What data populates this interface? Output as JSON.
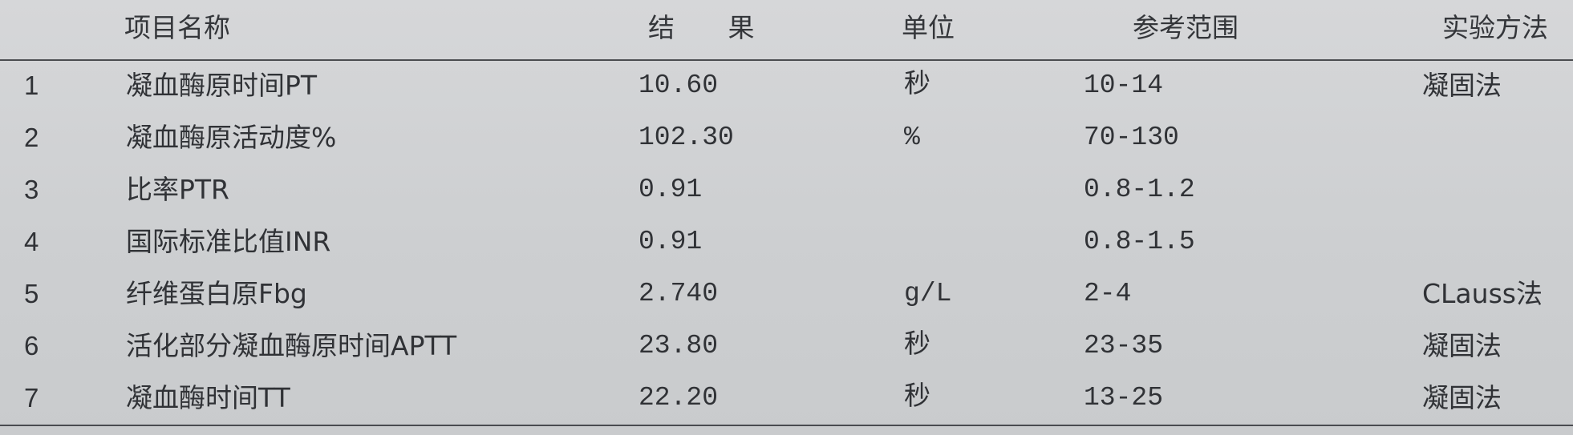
{
  "header": {
    "name": "项目名称",
    "result": "结 果",
    "unit": "单位",
    "reference": "参考范围",
    "method": "实验方法"
  },
  "rows": [
    {
      "index": "1",
      "name": "凝血酶原时间PT",
      "result": "10.60",
      "unit": "秒",
      "reference": "10-14",
      "method": "凝固法"
    },
    {
      "index": "2",
      "name": "凝血酶原活动度%",
      "result": "102.30",
      "unit": "%",
      "reference": "70-130",
      "method": ""
    },
    {
      "index": "3",
      "name": "比率PTR",
      "result": "0.91",
      "unit": "",
      "reference": "0.8-1.2",
      "method": ""
    },
    {
      "index": "4",
      "name": "国际标准比值INR",
      "result": "0.91",
      "unit": "",
      "reference": "0.8-1.5",
      "method": ""
    },
    {
      "index": "5",
      "name": "纤维蛋白原Fbg",
      "result": "2.740",
      "unit": "g/L",
      "reference": "2-4",
      "method": "CLauss法"
    },
    {
      "index": "6",
      "name": "活化部分凝血酶原时间APTT",
      "result": "23.80",
      "unit": "秒",
      "reference": "23-35",
      "method": "凝固法"
    },
    {
      "index": "7",
      "name": "凝血酶时间TT",
      "result": "22.20",
      "unit": "秒",
      "reference": "13-25",
      "method": "凝固法"
    }
  ]
}
